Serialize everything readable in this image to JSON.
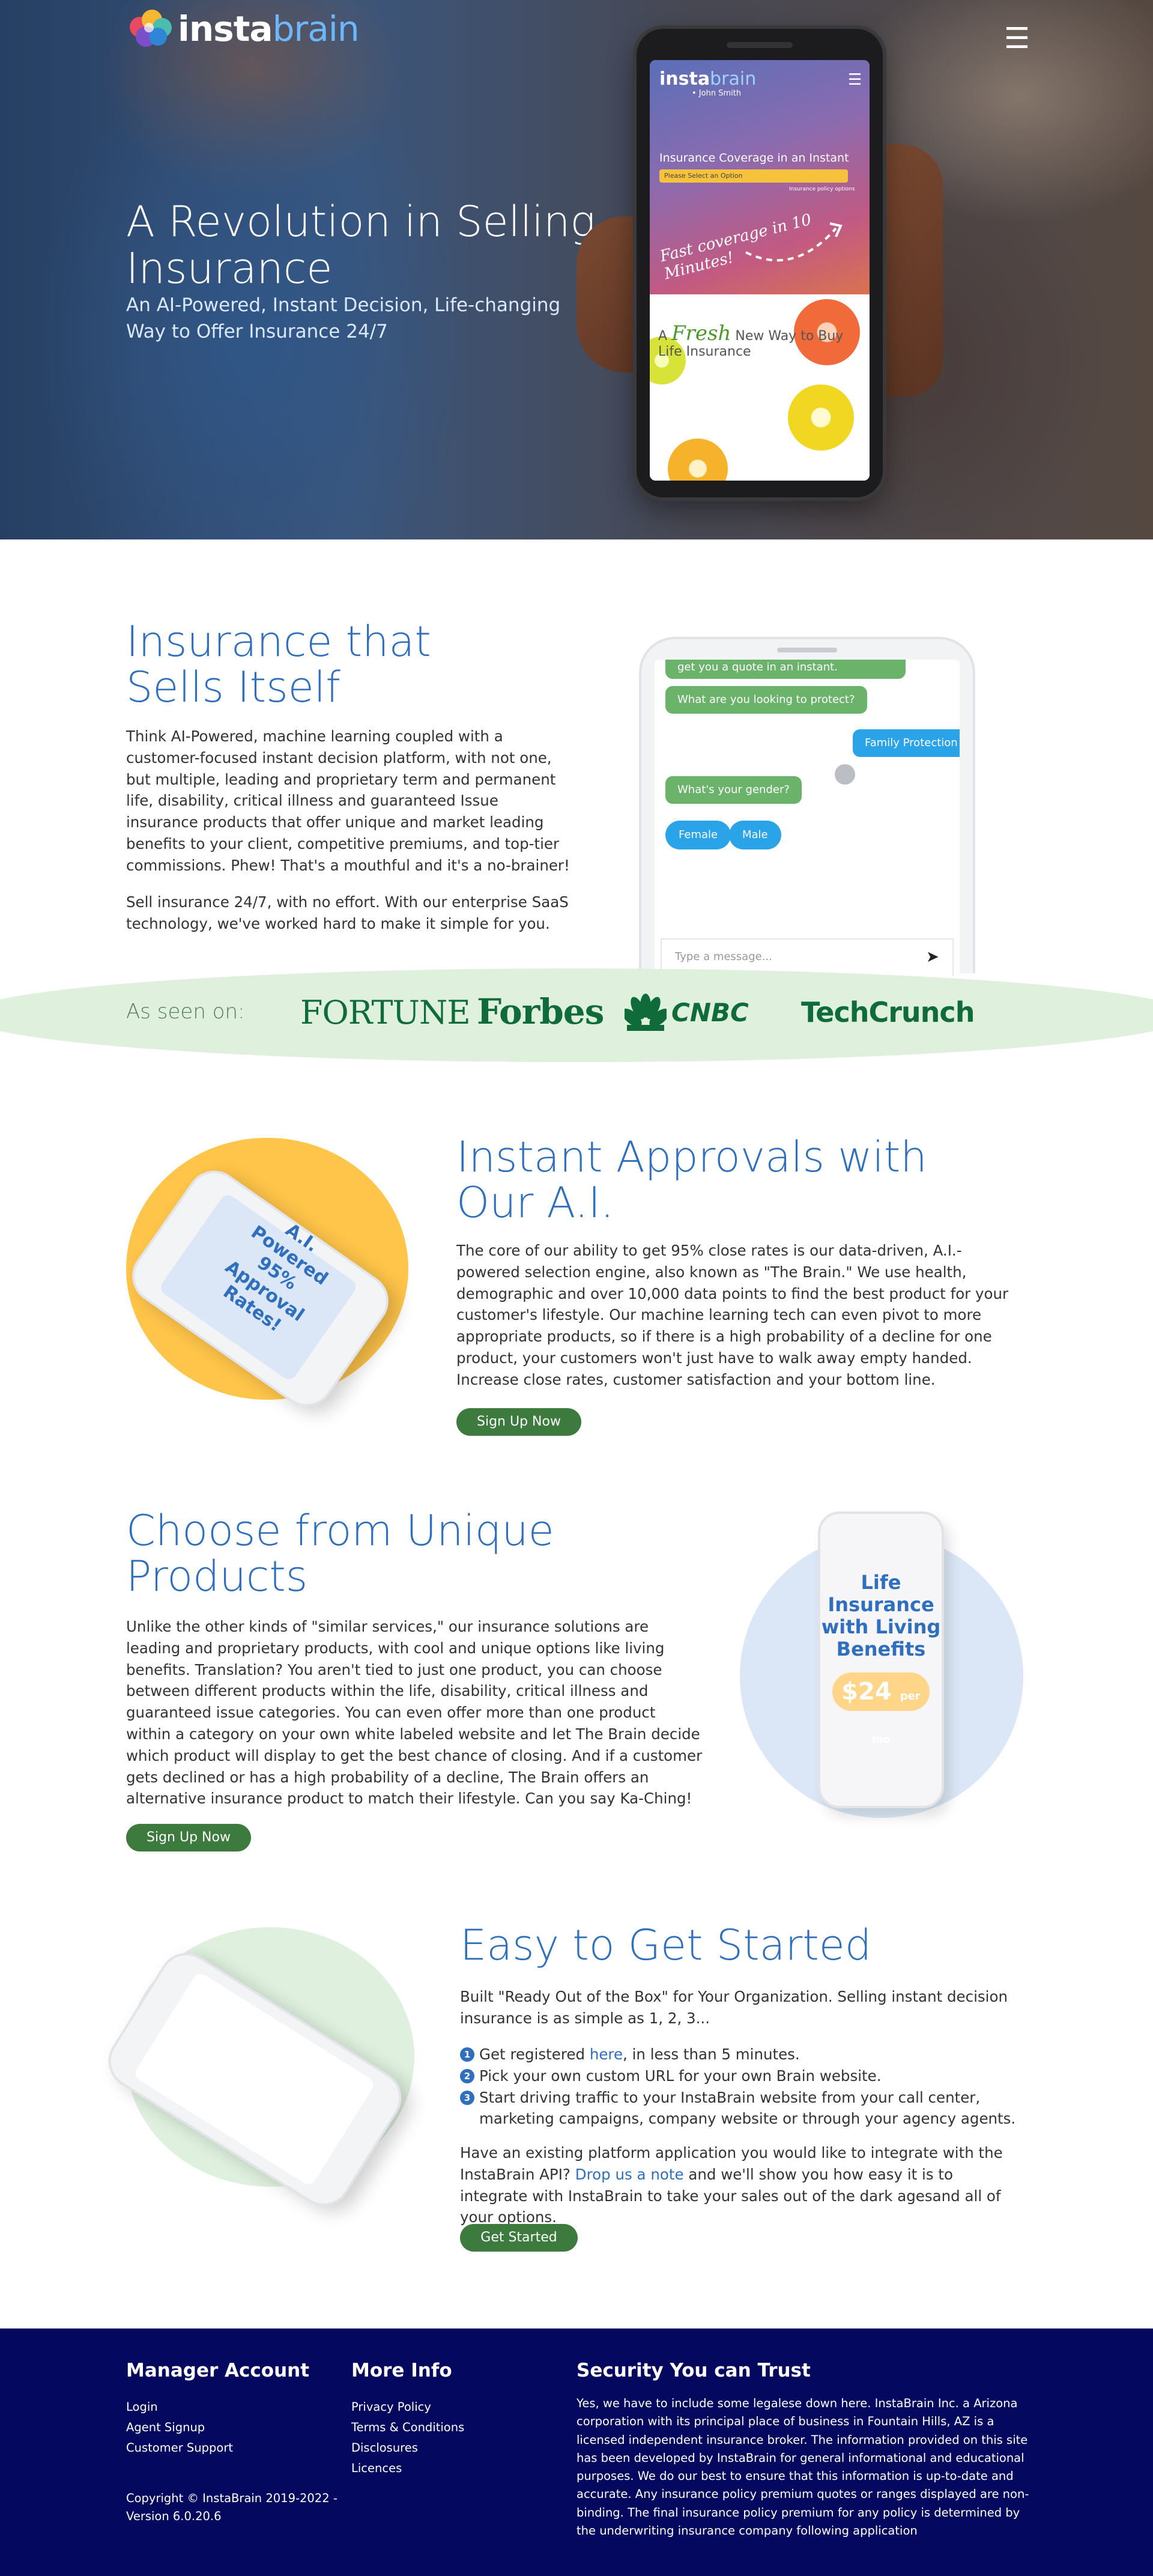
{
  "brand": {
    "logo_text_insta": "insta",
    "logo_text_brain": "brain"
  },
  "hero": {
    "title": "A Revolution in Selling Insurance",
    "subtitle": "An AI-Powered, Instant Decision, Life-changing Way to Offer Insurance 24/7",
    "menu_icon": "☰",
    "phone": {
      "logo_insta": "insta",
      "logo_brain": "brain",
      "byline": "• John Smith",
      "menu_icon": "☰",
      "coverage_label": "Insurance Coverage in an Instant",
      "select_placeholder": "Please Select an Option",
      "secure_note": "Insurance policy options",
      "fast_tagline": "Fast coverage in 10 Minutes!",
      "fresh_word": "Fresh",
      "fresh_prefix": "A",
      "fresh_rest": "New Way to Buy Life Insurance"
    }
  },
  "section_sells": {
    "title": "Insurance that Sells Itself",
    "paragraph1": "Think AI-Powered, machine learning coupled with a customer-focused instant decision platform, with not one, but multiple, leading and proprietary term and permanent life, disability, critical illness and guaranteed Issue insurance products that offer unique and market leading benefits to your client, competitive premiums, and top-tier commissions. Phew! That's a mouthful and it's a no-brainer!",
    "paragraph2": "Sell insurance 24/7, with no effort. With our enterprise SaaS technology, we've worked hard to make it simple for you.",
    "chat": {
      "bubble_top": "get you a quote in an instant.",
      "bubble_question": "What are you looking to protect?",
      "bubble_answer": "Family Protection",
      "bubble_gender": "What's your gender?",
      "option_female": "Female",
      "option_male": "Male",
      "input_placeholder": "Type a message...",
      "send_icon": "➤"
    }
  },
  "as_seen_on": {
    "label": "As seen on:",
    "brands": [
      "FORTUNE",
      "Forbes",
      "CNBC",
      "TechCrunch"
    ]
  },
  "section_approvals": {
    "title": "Instant Approvals with Our A.I.",
    "phone_text": "A.I. Powered 95% Approval Rates!",
    "paragraph": "The core of our ability to get 95% close rates is our data-driven, A.I.-powered selection engine, also known as \"The Brain.\" We use health, demographic and over 10,000 data points to find the best product for your customer's lifestyle. Our machine learning tech can even pivot to more appropriate products, so if there is a high probability of a decline for one product, your customers won't just have to walk away empty handed. Increase close rates, customer satisfaction and your bottom line.",
    "button": "Sign Up Now"
  },
  "section_products": {
    "title": "Choose from Unique Products",
    "paragraph": "Unlike the other kinds of \"similar services,\" our insurance solutions are leading and proprietary products, with cool and unique options like living benefits. Translation? You aren't tied to just one product, you can choose between different products within the life, disability, critical illness and guaranteed issue categories. You can even offer more than one product within a category on your own white labeled website and let The Brain decide which product will display to get the best chance of closing. And if a customer gets declined or has a high probability of a decline, The Brain offers an alternative insurance product to match their lifestyle. Can you say Ka-Ching!",
    "button": "Sign Up Now",
    "phone_text": "Life Insurance with Living Benefits",
    "price": "$24",
    "price_unit": "per mo"
  },
  "section_start": {
    "title": "Easy to Get Started",
    "intro": "Built \"Ready Out of the Box\" for Your Organization. Selling instant decision insurance is as simple as 1, 2, 3...",
    "steps": [
      {
        "num": "1",
        "before": "Get registered ",
        "link": "here",
        "after": ", in less than 5 minutes."
      },
      {
        "num": "2",
        "before": "Pick your own custom URL for your own Brain website.",
        "link": "",
        "after": ""
      },
      {
        "num": "3",
        "before": "Start driving traffic to your InstaBrain website from your call center, marketing campaigns, company website or through your agency agents.",
        "link": "",
        "after": ""
      }
    ],
    "api_before": "Have an existing platform application you would like to integrate with the InstaBrain API? ",
    "api_link": "Drop us a note",
    "api_after": " and we'll show you how easy it is to integrate with InstaBrain to take your sales out of the dark agesand all of your options.",
    "button": "Get Started"
  },
  "footer": {
    "col1_title": "Manager Account",
    "col1_links": [
      "Login",
      "Agent Signup",
      "Customer Support"
    ],
    "col2_title": "More Info",
    "col2_links": [
      "Privacy Policy",
      "Terms & Conditions",
      "Disclosures",
      "Licences"
    ],
    "col3_title": "Security You can Trust",
    "security_text": "Yes, we have to include some legalese down here. InstaBrain Inc. a Arizona corporation with its principal place of business in Fountain Hills, AZ is a licensed independent insurance broker. The information provided on this site has been developed by InstaBrain for general informational and educational purposes. We do our best to ensure that this information is up-to-date and accurate. Any insurance policy premium quotes or ranges displayed are non-binding. The final insurance policy premium for any policy is determined by the underwriting insurance company following application",
    "copyright": "Copyright © InstaBrain 2019-2022 - Version 6.0.20.6"
  },
  "colors": {
    "accent_blue": "#2f6fbe",
    "button_green": "#3d7a3d",
    "footer_navy": "#04085e",
    "seen_bg": "#dff0dd",
    "chat_green": "#6bb36b",
    "chat_blue": "#2aa3e8"
  }
}
